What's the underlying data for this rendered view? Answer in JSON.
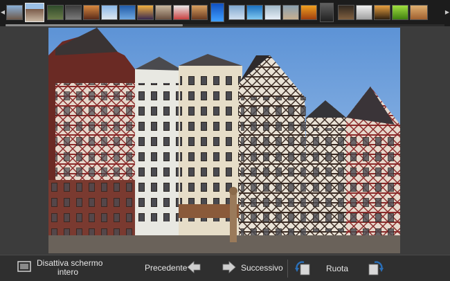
{
  "toolbar": {
    "fullscreen_label_line1": "Disattiva schermo",
    "fullscreen_label_line2": "intero",
    "previous_label": "Precedente",
    "next_label": "Successivo",
    "rotate_label": "Ruota"
  },
  "thumbnails": [
    {
      "icon": "city-thumbnail"
    },
    {
      "icon": "city-thumbnail"
    },
    {
      "icon": "nature-thumbnail"
    },
    {
      "icon": "car-thumbnail"
    },
    {
      "icon": "sunset-thumbnail"
    },
    {
      "icon": "sky-thumbnail"
    },
    {
      "icon": "blue-thumbnail"
    },
    {
      "icon": "sunset-thumbnail"
    },
    {
      "icon": "room-thumbnail"
    },
    {
      "icon": "plane-thumbnail"
    },
    {
      "icon": "food-thumbnail"
    },
    {
      "icon": "blue-thumbnail"
    },
    {
      "icon": "water-thumbnail"
    },
    {
      "icon": "blue-thumbnail"
    },
    {
      "icon": "ice-thumbnail"
    },
    {
      "icon": "landscape-thumbnail"
    },
    {
      "icon": "orange-thumbnail"
    },
    {
      "icon": "person-thumbnail"
    },
    {
      "icon": "dark-thumbnail"
    },
    {
      "icon": "light-thumbnail"
    },
    {
      "icon": "sunset-thumbnail"
    },
    {
      "icon": "green-thumbnail"
    },
    {
      "icon": "desert-thumbnail"
    }
  ],
  "colors": {
    "strip_bg": "#1c1c1c",
    "viewer_bg": "#3c3c3c",
    "toolbar_bg": "#2f2f2f",
    "arrow_blue": "#2a6fb8"
  }
}
